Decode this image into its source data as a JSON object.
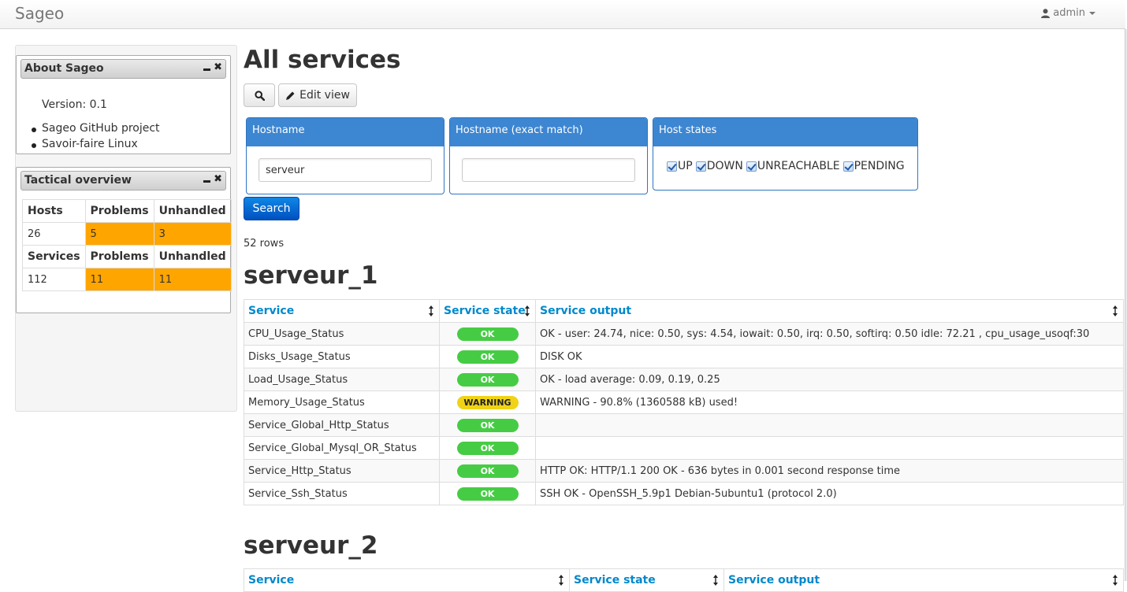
{
  "navbar": {
    "brand": "Sageo",
    "user": "admin"
  },
  "sidebar": {
    "about": {
      "title": "About Sageo",
      "version": "Version: 0.1",
      "links": [
        "Sageo GitHub project",
        "Savoir-faire Linux"
      ]
    },
    "tactical": {
      "title": "Tactical overview",
      "hosts_header": [
        "Hosts",
        "Problems",
        "Unhandled"
      ],
      "hosts_values": [
        "26",
        "5",
        "3"
      ],
      "services_header": [
        "Services",
        "Problems",
        "Unhandled"
      ],
      "services_values": [
        "112",
        "11",
        "11"
      ]
    }
  },
  "main": {
    "title": "All services",
    "edit_view_label": "Edit view",
    "search_label": "Search",
    "rows_count": "52 rows",
    "filters": {
      "hostname": {
        "label": "Hostname",
        "value": "serveur"
      },
      "hostname_exact": {
        "label": "Hostname (exact match)",
        "value": ""
      },
      "host_states": {
        "label": "Host states",
        "options": [
          "UP",
          "DOWN",
          "UNREACHABLE",
          "PENDING"
        ]
      }
    },
    "columns": [
      "Service",
      "Service state",
      "Service output"
    ],
    "hosts": [
      {
        "name": "serveur_1",
        "rows": [
          {
            "service": "CPU_Usage_Status",
            "state": "OK",
            "output": "OK - user: 24.74, nice: 0.50, sys: 4.54, iowait: 0.50, irq: 0.50, softirq: 0.50 idle: 72.21 , cpu_usage_usoqf:30"
          },
          {
            "service": "Disks_Usage_Status",
            "state": "OK",
            "output": "DISK OK"
          },
          {
            "service": "Load_Usage_Status",
            "state": "OK",
            "output": "OK - load average: 0.09, 0.19, 0.25"
          },
          {
            "service": "Memory_Usage_Status",
            "state": "WARNING",
            "output": "WARNING - 90.8% (1360588 kB) used!"
          },
          {
            "service": "Service_Global_Http_Status",
            "state": "OK",
            "output": ""
          },
          {
            "service": "Service_Global_Mysql_OR_Status",
            "state": "OK",
            "output": ""
          },
          {
            "service": "Service_Http_Status",
            "state": "OK",
            "output": "HTTP OK: HTTP/1.1 200 OK - 636 bytes in 0.001 second response time"
          },
          {
            "service": "Service_Ssh_Status",
            "state": "OK",
            "output": "SSH OK - OpenSSH_5.9p1 Debian-5ubuntu1 (protocol 2.0)"
          }
        ]
      },
      {
        "name": "serveur_2",
        "rows": []
      }
    ]
  },
  "colors": {
    "ok": "#46cc44",
    "warning": "#f0d317",
    "problem": "#ffa500",
    "link": "#0088cc",
    "filter_head": "#3d86d1"
  }
}
